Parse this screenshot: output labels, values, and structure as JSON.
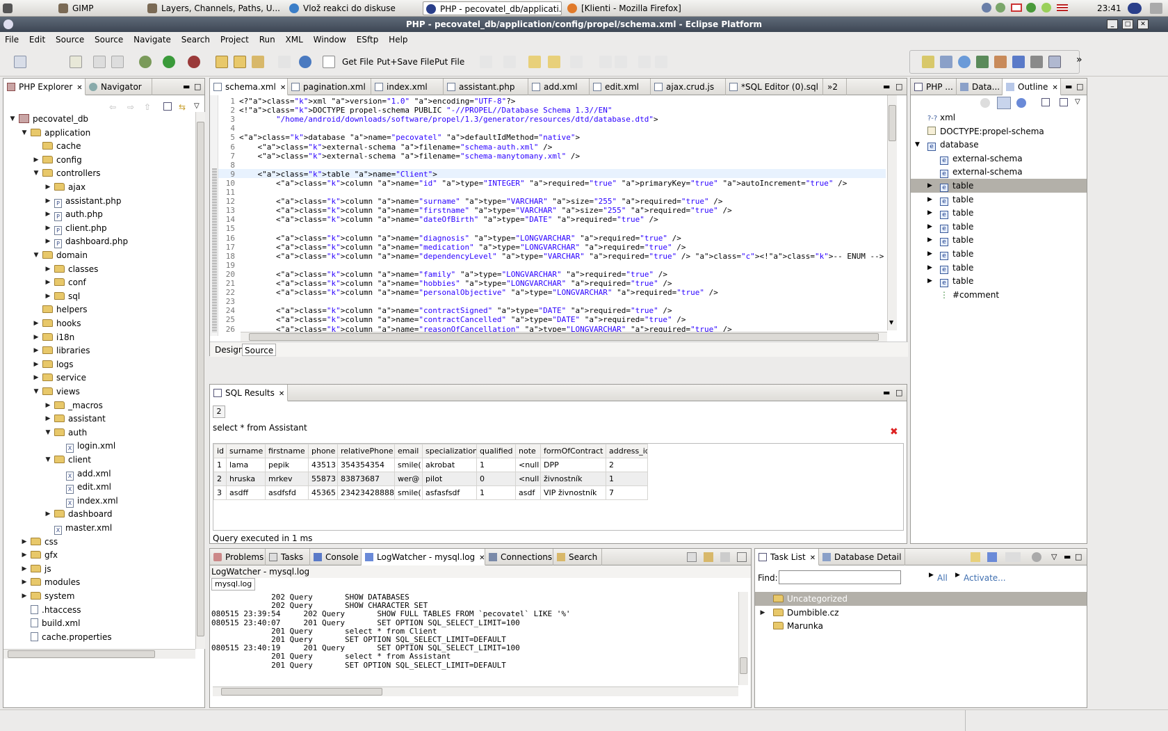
{
  "taskbar": {
    "items": [
      "GIMP",
      "Layers, Channels, Paths, U...",
      "Vlož reakci do diskuse",
      "PHP - pecovatel_db/applicati...",
      "[Klienti - Mozilla Firefox]"
    ],
    "clock": "23:41"
  },
  "window": {
    "title": "PHP - pecovatel_db/application/config/propel/schema.xml - Eclipse Platform"
  },
  "menu": [
    "File",
    "Edit",
    "Source",
    "Source",
    "Navigate",
    "Search",
    "Project",
    "Run",
    "XML",
    "Window",
    "ESftp",
    "Help"
  ],
  "toolbar": {
    "get_file": "Get File",
    "put_save_file": "Put+Save File",
    "put_file": "Put File"
  },
  "explorer": {
    "tabs": [
      "PHP Explorer",
      "Navigator"
    ],
    "tree": [
      {
        "label": "pecovatel_db",
        "depth": 0,
        "state": "open",
        "type": "project"
      },
      {
        "label": "application",
        "depth": 1,
        "state": "open",
        "type": "folder"
      },
      {
        "label": "cache",
        "depth": 2,
        "state": "none",
        "type": "folder"
      },
      {
        "label": "config",
        "depth": 2,
        "state": "closed",
        "type": "folder"
      },
      {
        "label": "controllers",
        "depth": 2,
        "state": "open",
        "type": "folder"
      },
      {
        "label": "ajax",
        "depth": 3,
        "state": "closed",
        "type": "folder"
      },
      {
        "label": "assistant.php",
        "depth": 3,
        "state": "closed",
        "type": "php"
      },
      {
        "label": "auth.php",
        "depth": 3,
        "state": "closed",
        "type": "php"
      },
      {
        "label": "client.php",
        "depth": 3,
        "state": "closed",
        "type": "php"
      },
      {
        "label": "dashboard.php",
        "depth": 3,
        "state": "closed",
        "type": "php"
      },
      {
        "label": "domain",
        "depth": 2,
        "state": "open",
        "type": "folder"
      },
      {
        "label": "classes",
        "depth": 3,
        "state": "closed",
        "type": "folder"
      },
      {
        "label": "conf",
        "depth": 3,
        "state": "closed",
        "type": "folder"
      },
      {
        "label": "sql",
        "depth": 3,
        "state": "closed",
        "type": "folder"
      },
      {
        "label": "helpers",
        "depth": 2,
        "state": "none",
        "type": "folder"
      },
      {
        "label": "hooks",
        "depth": 2,
        "state": "closed",
        "type": "folder"
      },
      {
        "label": "i18n",
        "depth": 2,
        "state": "closed",
        "type": "folder"
      },
      {
        "label": "libraries",
        "depth": 2,
        "state": "closed",
        "type": "folder"
      },
      {
        "label": "logs",
        "depth": 2,
        "state": "closed",
        "type": "folder"
      },
      {
        "label": "service",
        "depth": 2,
        "state": "closed",
        "type": "folder"
      },
      {
        "label": "views",
        "depth": 2,
        "state": "open",
        "type": "folder"
      },
      {
        "label": "_macros",
        "depth": 3,
        "state": "closed",
        "type": "folder"
      },
      {
        "label": "assistant",
        "depth": 3,
        "state": "closed",
        "type": "folder"
      },
      {
        "label": "auth",
        "depth": 3,
        "state": "open",
        "type": "folder"
      },
      {
        "label": "login.xml",
        "depth": 4,
        "state": "none",
        "type": "xml"
      },
      {
        "label": "client",
        "depth": 3,
        "state": "open",
        "type": "folder"
      },
      {
        "label": "add.xml",
        "depth": 4,
        "state": "none",
        "type": "xml"
      },
      {
        "label": "edit.xml",
        "depth": 4,
        "state": "none",
        "type": "xml"
      },
      {
        "label": "index.xml",
        "depth": 4,
        "state": "none",
        "type": "xml"
      },
      {
        "label": "dashboard",
        "depth": 3,
        "state": "closed",
        "type": "folder"
      },
      {
        "label": "master.xml",
        "depth": 3,
        "state": "none",
        "type": "xml"
      },
      {
        "label": "css",
        "depth": 1,
        "state": "closed",
        "type": "folder"
      },
      {
        "label": "gfx",
        "depth": 1,
        "state": "closed",
        "type": "folder"
      },
      {
        "label": "js",
        "depth": 1,
        "state": "closed",
        "type": "folder"
      },
      {
        "label": "modules",
        "depth": 1,
        "state": "closed",
        "type": "folder"
      },
      {
        "label": "system",
        "depth": 1,
        "state": "closed",
        "type": "folder"
      },
      {
        "label": ".htaccess",
        "depth": 1,
        "state": "none",
        "type": "file"
      },
      {
        "label": "build.xml",
        "depth": 1,
        "state": "none",
        "type": "file"
      },
      {
        "label": "cache.properties",
        "depth": 1,
        "state": "none",
        "type": "file"
      }
    ]
  },
  "editor": {
    "tabs": [
      "schema.xml",
      "pagination.xml",
      "index.xml",
      "assistant.php",
      "add.xml",
      "edit.xml",
      "ajax.crud.js",
      "*SQL Editor (0).sql"
    ],
    "overflow": "»2",
    "bottom_tabs": [
      "Design",
      "Source"
    ],
    "lines": [
      {
        "n": "1",
        "t": "<?xml version=\"1.0\" encoding=\"UTF-8\"?>"
      },
      {
        "n": "2",
        "t": "<!DOCTYPE propel-schema PUBLIC \"-//PROPEL//Database Schema 1.3//EN\""
      },
      {
        "n": "3",
        "t": "        \"/home/android/downloads/software/propel/1.3/generator/resources/dtd/database.dtd\">"
      },
      {
        "n": "4",
        "t": ""
      },
      {
        "n": "5",
        "t": "<database name=\"pecovatel\" defaultIdMethod=\"native\">"
      },
      {
        "n": "6",
        "t": "    <external-schema filename=\"schema-auth.xml\" />"
      },
      {
        "n": "7",
        "t": "    <external-schema filename=\"schema-manytomany.xml\" />"
      },
      {
        "n": "8",
        "t": ""
      },
      {
        "n": "9",
        "t": "    <table name=\"Client\">"
      },
      {
        "n": "10",
        "t": "        <column name=\"id\" type=\"INTEGER\" required=\"true\" primaryKey=\"true\" autoIncrement=\"true\" />"
      },
      {
        "n": "11",
        "t": ""
      },
      {
        "n": "12",
        "t": "        <column name=\"surname\" type=\"VARCHAR\" size=\"255\" required=\"true\" />"
      },
      {
        "n": "13",
        "t": "        <column name=\"firstname\" type=\"VARCHAR\" size=\"255\" required=\"true\" />"
      },
      {
        "n": "14",
        "t": "        <column name=\"dateOfBirth\" type=\"DATE\" required=\"true\" />"
      },
      {
        "n": "15",
        "t": ""
      },
      {
        "n": "16",
        "t": "        <column name=\"diagnosis\" type=\"LONGVARCHAR\" required=\"true\" />"
      },
      {
        "n": "17",
        "t": "        <column name=\"medication\" type=\"LONGVARCHAR\" required=\"true\" />"
      },
      {
        "n": "18",
        "t": "        <column name=\"dependencyLevel\" type=\"VARCHAR\" required=\"true\" /> <!-- ENUM -->"
      },
      {
        "n": "19",
        "t": ""
      },
      {
        "n": "20",
        "t": "        <column name=\"family\" type=\"LONGVARCHAR\" required=\"true\" />"
      },
      {
        "n": "21",
        "t": "        <column name=\"hobbies\" type=\"LONGVARCHAR\" required=\"true\" />"
      },
      {
        "n": "22",
        "t": "        <column name=\"personalObjective\" type=\"LONGVARCHAR\" required=\"true\" />"
      },
      {
        "n": "23",
        "t": ""
      },
      {
        "n": "24",
        "t": "        <column name=\"contractSigned\" type=\"DATE\" required=\"true\" />"
      },
      {
        "n": "25",
        "t": "        <column name=\"contractCancelled\" type=\"DATE\" required=\"true\" />"
      },
      {
        "n": "26",
        "t": "        <column name=\"reasonOfCancellation\" type=\"LONGVARCHAR\" required=\"true\" />"
      }
    ]
  },
  "outline": {
    "tabs": [
      "PHP ...",
      "Data...",
      "Outline"
    ],
    "items": [
      {
        "label": "xml",
        "depth": 0,
        "icon": "?-?",
        "state": "none"
      },
      {
        "label": "DOCTYPE:propel-schema",
        "depth": 0,
        "icon": "doc",
        "state": "none"
      },
      {
        "label": "database",
        "depth": 0,
        "icon": "e",
        "state": "open"
      },
      {
        "label": "external-schema",
        "depth": 1,
        "icon": "e",
        "state": "none"
      },
      {
        "label": "external-schema",
        "depth": 1,
        "icon": "e",
        "state": "none"
      },
      {
        "label": "table",
        "depth": 1,
        "icon": "e",
        "state": "closed",
        "selected": true
      },
      {
        "label": "table",
        "depth": 1,
        "icon": "e",
        "state": "closed"
      },
      {
        "label": "table",
        "depth": 1,
        "icon": "e",
        "state": "closed"
      },
      {
        "label": "table",
        "depth": 1,
        "icon": "e",
        "state": "closed"
      },
      {
        "label": "table",
        "depth": 1,
        "icon": "e",
        "state": "closed"
      },
      {
        "label": "table",
        "depth": 1,
        "icon": "e",
        "state": "closed"
      },
      {
        "label": "table",
        "depth": 1,
        "icon": "e",
        "state": "closed"
      },
      {
        "label": "table",
        "depth": 1,
        "icon": "e",
        "state": "closed"
      },
      {
        "label": "#comment",
        "depth": 1,
        "icon": "comment",
        "state": "none"
      }
    ]
  },
  "sql_results": {
    "tab": "SQL Results",
    "subtab": "2",
    "query": "select * from Assistant",
    "columns": [
      "id",
      "surname",
      "firstname",
      "phone",
      "relativePhone",
      "email",
      "specialization",
      "qualified",
      "note",
      "formOfContract",
      "address_id"
    ],
    "rows": [
      [
        "1",
        "lama",
        "pepik",
        "43513",
        "354354354",
        "smile(",
        "akrobat",
        "1",
        "<null",
        "DPP",
        "2"
      ],
      [
        "2",
        "hruska",
        "mrkev",
        "55873",
        "83873687",
        "wer@",
        "pilot",
        "0",
        "<null",
        "živnostník",
        "1"
      ],
      [
        "3",
        "asdff",
        "asdfsfd",
        "45365",
        "23423428888",
        "smile(",
        "asfasfsdf",
        "1",
        "asdf",
        "VIP živnostník",
        "7"
      ]
    ],
    "status": "Query executed in 1 ms"
  },
  "log_panel": {
    "tabs": [
      "Problems",
      "Tasks",
      "Console",
      "LogWatcher - mysql.log",
      "Connections",
      "Search"
    ],
    "title": "LogWatcher - mysql.log",
    "subtab": "mysql.log",
    "lines": [
      "             202 Query       SHOW DATABASES",
      "             202 Query       SHOW CHARACTER SET",
      "080515 23:39:54     202 Query       SHOW FULL TABLES FROM `pecovatel` LIKE '%'",
      "080515 23:40:07     201 Query       SET OPTION SQL_SELECT_LIMIT=100",
      "             201 Query       select * from Client",
      "             201 Query       SET OPTION SQL_SELECT_LIMIT=DEFAULT",
      "080515 23:40:19     201 Query       SET OPTION SQL_SELECT_LIMIT=100",
      "             201 Query       select * from Assistant",
      "             201 Query       SET OPTION SQL_SELECT_LIMIT=DEFAULT"
    ]
  },
  "task_panel": {
    "tabs": [
      "Task List",
      "Database Detail"
    ],
    "find_label": "Find:",
    "find_value": "",
    "all_label": "All",
    "activate_label": "Activate...",
    "items": [
      {
        "label": "Uncategorized",
        "state": "none",
        "selected": true
      },
      {
        "label": "Dumbible.cz",
        "state": "closed"
      },
      {
        "label": "Marunka",
        "state": "none"
      }
    ]
  },
  "colors": {
    "selection": "#b3b0a9",
    "accent": "#3f6fb0",
    "close": "#d22"
  }
}
